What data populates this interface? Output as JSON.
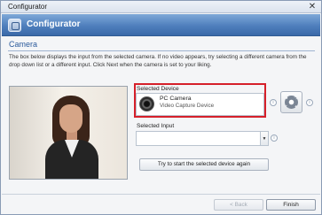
{
  "window": {
    "title": "Configurator",
    "close_label": "✕"
  },
  "banner": {
    "title": "Configurator",
    "icon": "configurator-icon"
  },
  "section": {
    "title": "Camera",
    "description": "The box below displays the input from the selected camera. If no video appears, try selecting a different camera from the drop down list or a different input. Click Next when the camera is set to your liking."
  },
  "device": {
    "label": "Selected Device",
    "name": "PC Camera",
    "subtitle": "Video Capture Device",
    "icon": "webcam-icon",
    "info_glyph": "i",
    "settings_icon": "gear-icon"
  },
  "input": {
    "label": "Selected Input",
    "value": "",
    "arrow_glyph": "▼",
    "info_glyph": "i"
  },
  "buttons": {
    "retry": "Try to start the selected device again",
    "back": "< Back",
    "finish": "Finish"
  },
  "colors": {
    "banner": "#4f7fbd",
    "highlight": "#d6202a",
    "section_title": "#2c5b9c"
  }
}
